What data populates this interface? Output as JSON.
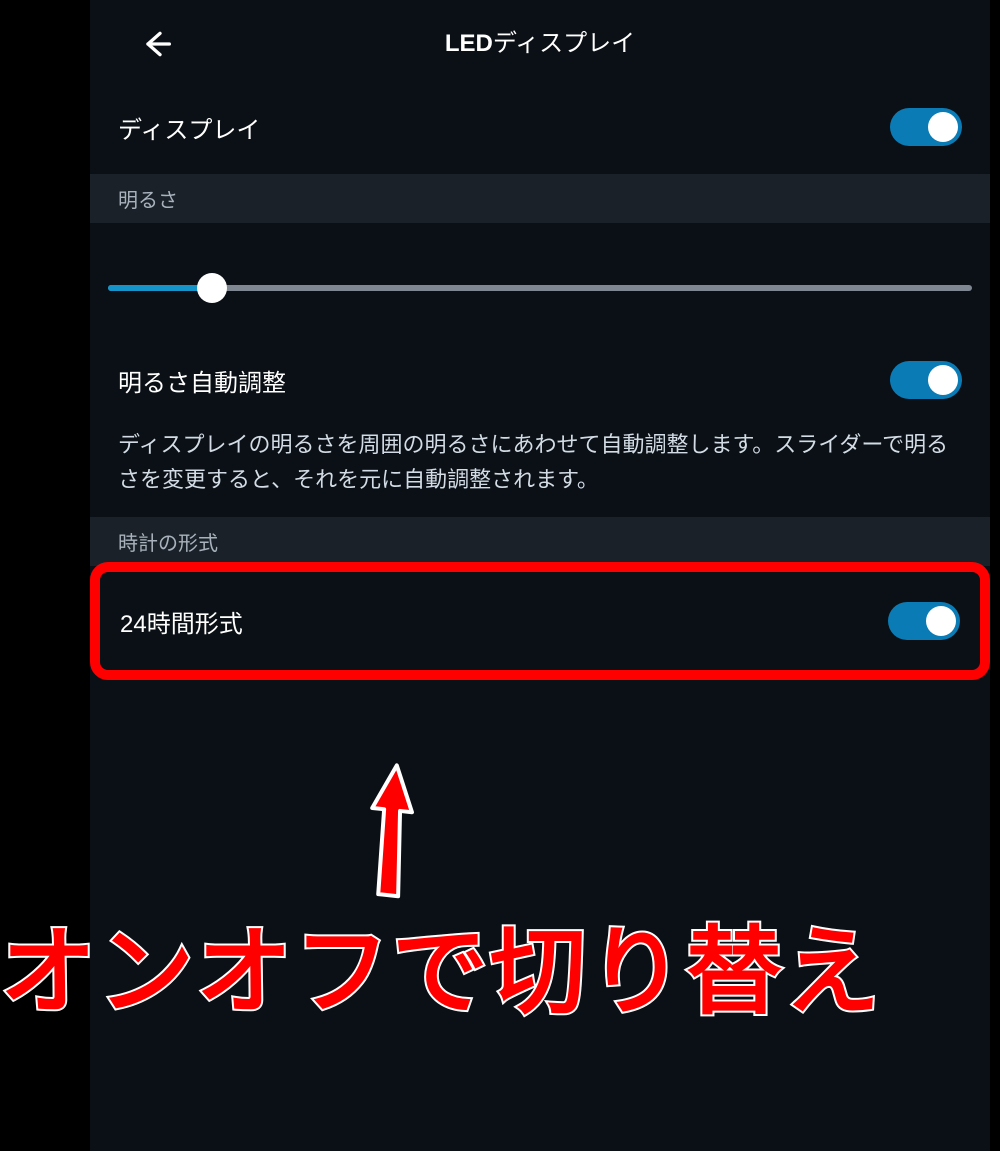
{
  "header": {
    "title_bold": "LED",
    "title_rest": "ディスプレイ"
  },
  "display_row": {
    "label": "ディスプレイ",
    "on": true
  },
  "brightness": {
    "section_label": "明るさ",
    "value_percent": 12
  },
  "auto_brightness": {
    "label": "明るさ自動調整",
    "on": true,
    "description": "ディスプレイの明るさを周囲の明るさにあわせて自動調整します。スライダーで明るさを変更すると、それを元に自動調整されます。"
  },
  "clock_format": {
    "section_label": "時計の形式",
    "label": "24時間形式",
    "on": true
  },
  "annotation": {
    "text": "オンオフで切り替え"
  },
  "colors": {
    "accent": "#0b7bb5",
    "slider_fill": "#1594c9",
    "highlight": "#ff0000"
  }
}
